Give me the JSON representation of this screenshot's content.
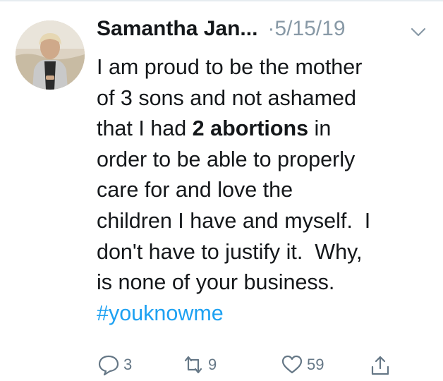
{
  "tweet": {
    "author_name": "Samantha Jan...",
    "separator": "·",
    "date": "5/15/19",
    "text_lines": [
      {
        "segments": [
          {
            "text": "I am proud to be the mother",
            "style": "normal"
          }
        ]
      },
      {
        "segments": [
          {
            "text": "of 3 sons and not ashamed",
            "style": "normal"
          }
        ]
      },
      {
        "segments": [
          {
            "text": "that I had ",
            "style": "normal"
          },
          {
            "text": "2 abortions",
            "style": "bold"
          },
          {
            "text": " in",
            "style": "normal"
          }
        ]
      },
      {
        "segments": [
          {
            "text": "order to be able to properly",
            "style": "normal"
          }
        ]
      },
      {
        "segments": [
          {
            "text": "care for and love the",
            "style": "normal"
          }
        ]
      },
      {
        "segments": [
          {
            "text": "children I have and myself.  I",
            "style": "normal"
          }
        ]
      },
      {
        "segments": [
          {
            "text": "don't have to justify it.  Why,",
            "style": "normal"
          }
        ]
      },
      {
        "segments": [
          {
            "text": "is none of your business.",
            "style": "normal"
          }
        ]
      },
      {
        "segments": [
          {
            "text": "#youknowme",
            "style": "hashtag"
          }
        ]
      }
    ],
    "actions": {
      "reply_count": "3",
      "retweet_count": "9",
      "like_count": "59"
    },
    "icons": {
      "reply": "reply-icon",
      "retweet": "retweet-icon",
      "like": "heart-icon",
      "share": "share-icon",
      "menu": "chevron-down-icon"
    },
    "colors": {
      "hashtag": "#1da1f2",
      "meta_gray": "#8899a6",
      "action_gray": "#657786",
      "text": "#14171a"
    }
  }
}
